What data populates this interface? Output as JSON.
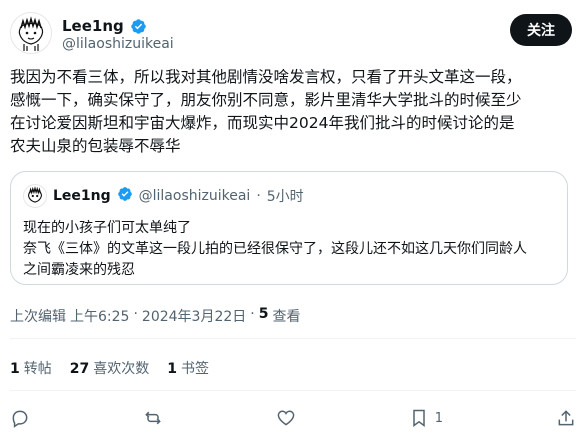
{
  "header": {
    "display_name": "Lee1ng",
    "handle": "@lilaoshizuikeai",
    "follow_label": "关注"
  },
  "post": {
    "text": "我因为不看三体，所以我对其他剧情没啥发言权，只看了开头文革这一段，\n感慨一下，确实保守了，朋友你别不同意，影片里清华大学批斗的时候至少\n在讨论爱因斯坦和宇宙大爆炸，而现实中2024年我们批斗的时候讨论的是\n农夫山泉的包装辱不辱华"
  },
  "quote": {
    "display_name": "Lee1ng",
    "handle": "@lilaoshizuikeai",
    "dot": "·",
    "time": "5小时",
    "text": "现在的小孩子们可太单纯了\n奈飞《三体》的文革这一段儿拍的已经很保守了，这段儿还不如这几天你们同龄人\n之间霸凌来的残忍"
  },
  "meta": {
    "edited": "上次编辑",
    "time": "上午6:25",
    "sep1": "·",
    "date": "2024年3月22日",
    "sep2": "·",
    "views_count": "5",
    "views_label": "查看"
  },
  "stats": {
    "reposts_count": "1",
    "reposts_label": "转帖",
    "likes_count": "27",
    "likes_label": "喜欢次数",
    "bookmarks_count": "1",
    "bookmarks_label": "书签"
  },
  "actions": {
    "bookmark_count": "1"
  },
  "colors": {
    "text": "#0f1419",
    "muted": "#536471",
    "verified": "#1d9bf0",
    "border": "#cfd9de"
  }
}
